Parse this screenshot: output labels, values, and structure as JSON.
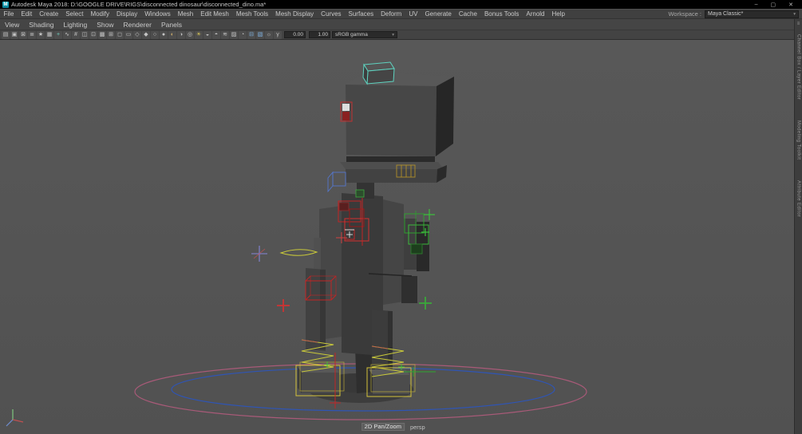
{
  "window": {
    "title": "Autodesk Maya 2018: D:\\GOOGLE DRIVE\\RIGS\\disconnected dinosaur\\disconnected_dino.ma*",
    "app_badge": "M",
    "controls": {
      "minimize": "–",
      "maximize": "▢",
      "close": "✕"
    }
  },
  "menu_bar": {
    "items": [
      "File",
      "Edit",
      "Create",
      "Select",
      "Modify",
      "Display",
      "Windows",
      "Mesh",
      "Edit Mesh",
      "Mesh Tools",
      "Mesh Display",
      "Curves",
      "Surfaces",
      "Deform",
      "UV",
      "Generate",
      "Cache",
      "Bonus Tools",
      "Arnold",
      "Help"
    ],
    "workspace_label": "Workspace :",
    "workspace_value": "Maya Classic*"
  },
  "panel_menu": {
    "items": [
      "View",
      "Shading",
      "Lighting",
      "Show",
      "Renderer",
      "Panels"
    ]
  },
  "panel_toolbar": {
    "icons": [
      {
        "name": "panel-layout-icon",
        "glyph": "▤",
        "color": "#c4c4c4"
      },
      {
        "name": "select-camera-icon",
        "glyph": "▣",
        "color": "#c4c4c4"
      },
      {
        "name": "lock-camera-icon",
        "glyph": "⊠",
        "color": "#c4c4c4"
      },
      {
        "name": "camera-attributes-icon",
        "glyph": "≣",
        "color": "#c4c4c4"
      },
      {
        "name": "bookmark-icon",
        "glyph": "★",
        "color": "#c4c4c4"
      },
      {
        "name": "image-plane-icon",
        "glyph": "▦",
        "color": "#c4c4c4"
      },
      {
        "name": "pan-zoom-icon",
        "glyph": "+",
        "color": "#6fd0c0"
      },
      {
        "name": "grease-pencil-icon",
        "glyph": "∿",
        "color": "#c4c4c4"
      },
      {
        "name": "grid-icon",
        "glyph": "#",
        "color": "#c4c4c4"
      },
      {
        "name": "film-gate-icon",
        "glyph": "◫",
        "color": "#c4c4c4"
      },
      {
        "name": "resolution-gate-icon",
        "glyph": "⊡",
        "color": "#c4c4c4"
      },
      {
        "name": "gate-mask-icon",
        "glyph": "▩",
        "color": "#c4c4c4"
      },
      {
        "name": "field-chart-icon",
        "glyph": "⊞",
        "color": "#c4c4c4"
      },
      {
        "name": "safe-action-icon",
        "glyph": "◻",
        "color": "#c4c4c4"
      },
      {
        "name": "safe-title-icon",
        "glyph": "▭",
        "color": "#c4c4c4"
      },
      {
        "name": "frame-all-icon",
        "glyph": "◇",
        "color": "#c4c4c4"
      },
      {
        "name": "frame-selection-icon",
        "glyph": "◆",
        "color": "#c4c4c4"
      },
      {
        "name": "wireframe-icon",
        "glyph": "○",
        "color": "#c4c4c4"
      },
      {
        "name": "smooth-shade-icon",
        "glyph": "●",
        "color": "#c4c4c4"
      },
      {
        "name": "textured-icon",
        "glyph": "◐",
        "color": "#c8a868"
      },
      {
        "name": "default-material-icon",
        "glyph": "◑",
        "color": "#c4c4c4"
      },
      {
        "name": "wireframe-on-shaded-icon",
        "glyph": "◎",
        "color": "#c4c4c4"
      },
      {
        "name": "lights-icon",
        "glyph": "☀",
        "color": "#d8c558"
      },
      {
        "name": "shadows-icon",
        "glyph": "◒",
        "color": "#c4c4c4"
      },
      {
        "name": "ssao-icon",
        "glyph": "◓",
        "color": "#c4c4c4"
      },
      {
        "name": "motion-blur-icon",
        "glyph": "≋",
        "color": "#c4c4c4"
      },
      {
        "name": "multisample-icon",
        "glyph": "▨",
        "color": "#c4c4c4"
      },
      {
        "name": "depth-of-field-icon",
        "glyph": "◔",
        "color": "#c4c4c4"
      },
      {
        "name": "isolate-select-icon",
        "glyph": "⊟",
        "color": "#7fb2e0"
      },
      {
        "name": "xray-icon",
        "glyph": "▧",
        "color": "#7fb2e0"
      },
      {
        "name": "exposure-toggle-icon",
        "glyph": "☼",
        "color": "#c4c4c4"
      },
      {
        "name": "gamma-toggle-icon",
        "glyph": "γ",
        "color": "#c4c4c4"
      }
    ],
    "exposure": "0.00",
    "gamma": "1.00",
    "view_transform": "sRGB gamma"
  },
  "viewport": {
    "hud_pan_zoom": "2D Pan/Zoom",
    "camera": "persp"
  },
  "right_tabs": [
    "Channel Box / Layer Editor",
    "Modeling Toolkit",
    "Attribute Editor"
  ],
  "colors": {
    "viewport_bg": "#545454",
    "selection_highlight": "#5fd3c0",
    "rig_red": "#c22424",
    "rig_green": "#3cb83c",
    "rig_yellow": "#d4c23a",
    "ground_circle_blue": "#2f55b5",
    "ground_circle_pink": "#a85a78"
  }
}
